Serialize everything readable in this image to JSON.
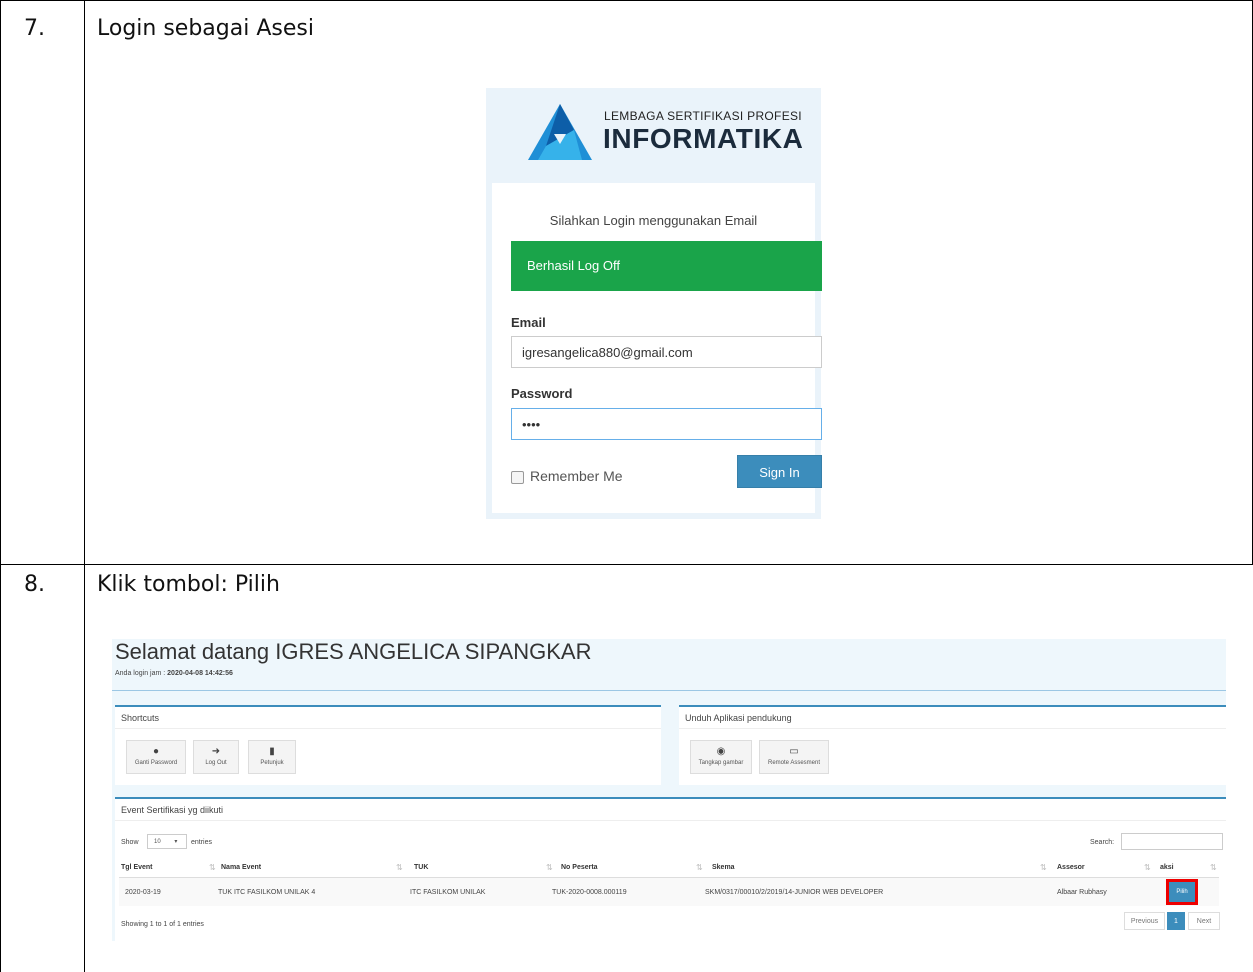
{
  "steps": [
    {
      "number": "7.",
      "title": "Login sebagai Asesi"
    },
    {
      "number": "8.",
      "title": "Klik tombol: Pilih"
    }
  ],
  "login": {
    "logo_small": "LEMBAGA SERTIFIKASI PROFESI",
    "logo_big": "INFORMATIKA",
    "message": "Silahkan Login menggunakan Email",
    "alert": "Berhasil Log Off",
    "email_label": "Email",
    "email_value": "igresangelica880@gmail.com",
    "password_label": "Password",
    "password_value": "••••",
    "remember_label": "Remember Me",
    "signin_label": "Sign In",
    "colors": {
      "alert": "#1aa44a",
      "button": "#3c8dbc",
      "panel": "#eaf3fa"
    }
  },
  "dashboard": {
    "welcome": "Selamat datang IGRES ANGELICA SIPANGKAR",
    "login_time_label": "Anda login jam :",
    "login_time": "2020-04-08 14:42:56",
    "shortcuts": {
      "title": "Shortcuts",
      "items": [
        {
          "icon": "user-icon",
          "label": "Ganti Password"
        },
        {
          "icon": "logout-icon",
          "label": "Log Out"
        },
        {
          "icon": "book-icon",
          "label": "Petunjuk"
        }
      ]
    },
    "downloads": {
      "title": "Unduh Aplikasi pendukung",
      "items": [
        {
          "icon": "camera-icon",
          "label": "Tangkap gambar"
        },
        {
          "icon": "monitor-icon",
          "label": "Remote Assesment"
        }
      ]
    },
    "events": {
      "title": "Event Sertifikasi yg diikuti",
      "show_label": "Show",
      "page_size": "10",
      "entries_label": "entries",
      "search_label": "Search:",
      "columns": [
        "Tgl Event",
        "Nama Event",
        "TUK",
        "No Peserta",
        "Skema",
        "Assesor",
        "aksi"
      ],
      "rows": [
        [
          "2020-03-19",
          "TUK ITC FASILKOM UNILAK 4",
          "ITC FASILKOM UNILAK",
          "TUK-2020-0008.000119",
          "SKM/0317/00010/2/2019/14-JUNIOR WEB DEVELOPER",
          "Albaar Rubhasy"
        ]
      ],
      "action_label": "Pilih",
      "info": "Showing 1 to 1 of 1 entries",
      "pagination": {
        "previous": "Previous",
        "page": "1",
        "next": "Next"
      },
      "highlight_color": "#e00000"
    }
  }
}
